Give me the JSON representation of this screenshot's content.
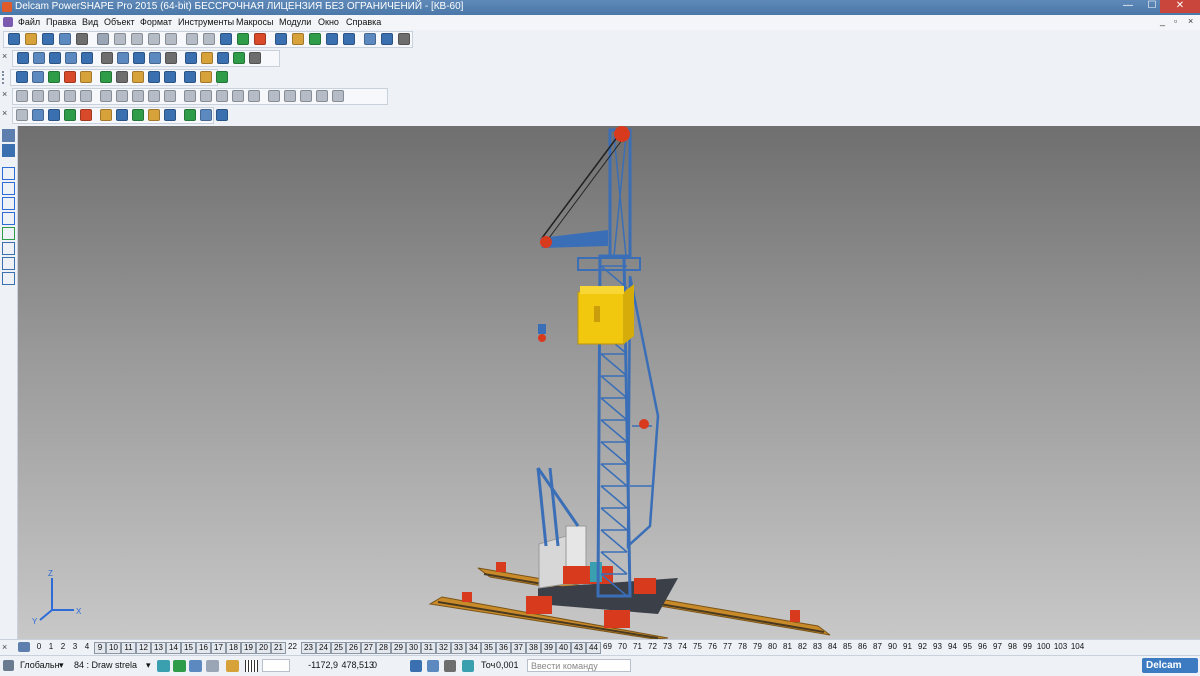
{
  "window": {
    "title": "Delcam PowerSHAPE Pro 2015 (64-bit) БЕССРОЧНАЯ ЛИЦЕНЗИЯ БЕЗ ОГРАНИЧЕНИЙ - [КВ-60]",
    "minimize": "—",
    "maximize": "☐",
    "close": "✕"
  },
  "menu": {
    "items": [
      "Файл",
      "Правка",
      "Вид",
      "Объект",
      "Формат",
      "Инструменты",
      "Макросы",
      "Модули",
      "Окно",
      "Справка"
    ],
    "mdi_controls": [
      "_",
      "▫",
      "×"
    ]
  },
  "toolbars": {
    "close_glyph": "×",
    "row_colors": [
      [
        "#3a6fb0",
        "#d8a23a",
        "#3a6fb0",
        "#5c8ac0",
        "#6e6e6e",
        "#9aa6b5",
        "#b5bcc6",
        "#b5bcc6",
        "#b5bcc6",
        "#b5bcc6",
        "#b5bcc6",
        "#b5bcc6",
        "#3a6fb0",
        "#2f9c4a",
        "#d84a2a",
        "#3a6fb0",
        "#d8a23a",
        "#2f9c4a",
        "#3a6fb0",
        "#3a6fb0",
        "#5c8ac0",
        "#3a6fb0",
        "#6e6e6e"
      ],
      [
        "#3a6fb0",
        "#5c8ac0",
        "#3a6fb0",
        "#5c8ac0",
        "#3a6fb0",
        "#6e6e6e",
        "#5c8ac0",
        "#3a6fb0",
        "#5c8ac0",
        "#6e6e6e",
        "#3a6fb0",
        "#d8a23a",
        "#3a6fb0",
        "#2f9c4a",
        "#6e6e6e"
      ],
      [
        "#3a6fb0",
        "#5c8ac0",
        "#2f9c4a",
        "#d84a2a",
        "#d8a23a",
        "#2f9c4a",
        "#6e6e6e",
        "#d8a23a",
        "#3a6fb0",
        "#3a6fb0",
        "#3a6fb0",
        "#d8a23a",
        "#2f9c4a"
      ],
      [
        "#b5bcc6",
        "#b5bcc6",
        "#b5bcc6",
        "#b5bcc6",
        "#b5bcc6",
        "#b5bcc6",
        "#b5bcc6",
        "#b5bcc6",
        "#b5bcc6",
        "#b5bcc6",
        "#b5bcc6",
        "#b5bcc6",
        "#b5bcc6",
        "#b5bcc6",
        "#b5bcc6",
        "#b5bcc6",
        "#b5bcc6",
        "#b5bcc6",
        "#b5bcc6",
        "#b5bcc6"
      ],
      [
        "#b5bcc6",
        "#5c8ac0",
        "#3a6fb0",
        "#2f9c4a",
        "#d84a2a",
        "#d8a23a",
        "#3a6fb0",
        "#2f9c4a",
        "#d8a23a",
        "#3a6fb0",
        "#2f9c4a",
        "#5c8ac0",
        "#3a6fb0"
      ]
    ]
  },
  "left_toolbar": {
    "icons": [
      "select-icon",
      "quick-select-icon",
      "line-icon",
      "curve-icon",
      "rectangle-icon",
      "circle-icon",
      "solid-icon",
      "dimension-icon",
      "surface-icon",
      "annotation-icon"
    ]
  },
  "viewport": {
    "accent_blue": "#3a6fb8",
    "cabin_yellow": "#f2c80f",
    "red": "#d83a1e",
    "rail_orange": "#c98a2a",
    "axes": {
      "x": "X",
      "y": "Y",
      "z": "Z"
    }
  },
  "levels": {
    "items": [
      "0",
      "1",
      "2",
      "3",
      "4",
      "9",
      "10",
      "11",
      "12",
      "13",
      "14",
      "15",
      "16",
      "17",
      "18",
      "19",
      "20",
      "21",
      "22",
      "23",
      "24",
      "25",
      "26",
      "27",
      "28",
      "29",
      "30",
      "31",
      "32",
      "33",
      "34",
      "35",
      "36",
      "37",
      "38",
      "39",
      "40",
      "43",
      "44",
      "69",
      "70",
      "71",
      "72",
      "73",
      "74",
      "75",
      "76",
      "77",
      "78",
      "79",
      "80",
      "81",
      "82",
      "83",
      "84",
      "85",
      "86",
      "87",
      "90",
      "91",
      "92",
      "93",
      "94",
      "95",
      "96",
      "97",
      "98",
      "99",
      "100",
      "103",
      "104"
    ],
    "boxed": [
      "9",
      "10",
      "11",
      "12",
      "13",
      "14",
      "15",
      "16",
      "17",
      "18",
      "19",
      "20",
      "21",
      "23",
      "24",
      "25",
      "26",
      "27",
      "28",
      "29",
      "30",
      "31",
      "32",
      "33",
      "34",
      "35",
      "36",
      "37",
      "38",
      "39",
      "40",
      "43",
      "44"
    ]
  },
  "status": {
    "workplane": "Глобальн",
    "level": "84 : Draw strela",
    "x": "-1172,9",
    "y": "478,513",
    "z": "0",
    "tolerance_label": "Точ",
    "tolerance": "0,001",
    "command_placeholder": "Ввести команду",
    "brand": "Delcam"
  }
}
